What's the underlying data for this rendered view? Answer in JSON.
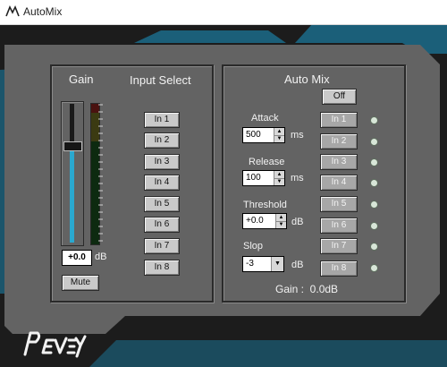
{
  "window": {
    "title": "AutoMix"
  },
  "gain_section": {
    "heading": "Gain",
    "value": "+0.0",
    "unit": "dB",
    "mute_label": "Mute",
    "fader_level": 0.68
  },
  "input_select": {
    "heading": "Input Select",
    "buttons": [
      "In 1",
      "In 2",
      "In 3",
      "In 4",
      "In 5",
      "In 6",
      "In 7",
      "In 8"
    ]
  },
  "auto_mix": {
    "heading": "Auto Mix",
    "off_label": "Off",
    "attack": {
      "label": "Attack",
      "value": "500",
      "unit": "ms"
    },
    "release": {
      "label": "Release",
      "value": "100",
      "unit": "ms"
    },
    "threshold": {
      "label": "Threshold",
      "value": "+0.0",
      "unit": "dB"
    },
    "slop": {
      "label": "Slop",
      "value": "-3",
      "unit": "dB"
    },
    "channels": [
      "In 1",
      "In 2",
      "In 3",
      "In 4",
      "In 5",
      "In 6",
      "In 7",
      "In 8"
    ],
    "gain_readout": "Gain :  0.0dB"
  },
  "colors": {
    "accent": "#2aa8cf",
    "panel": "#636363",
    "led": "#d8e6d8"
  }
}
